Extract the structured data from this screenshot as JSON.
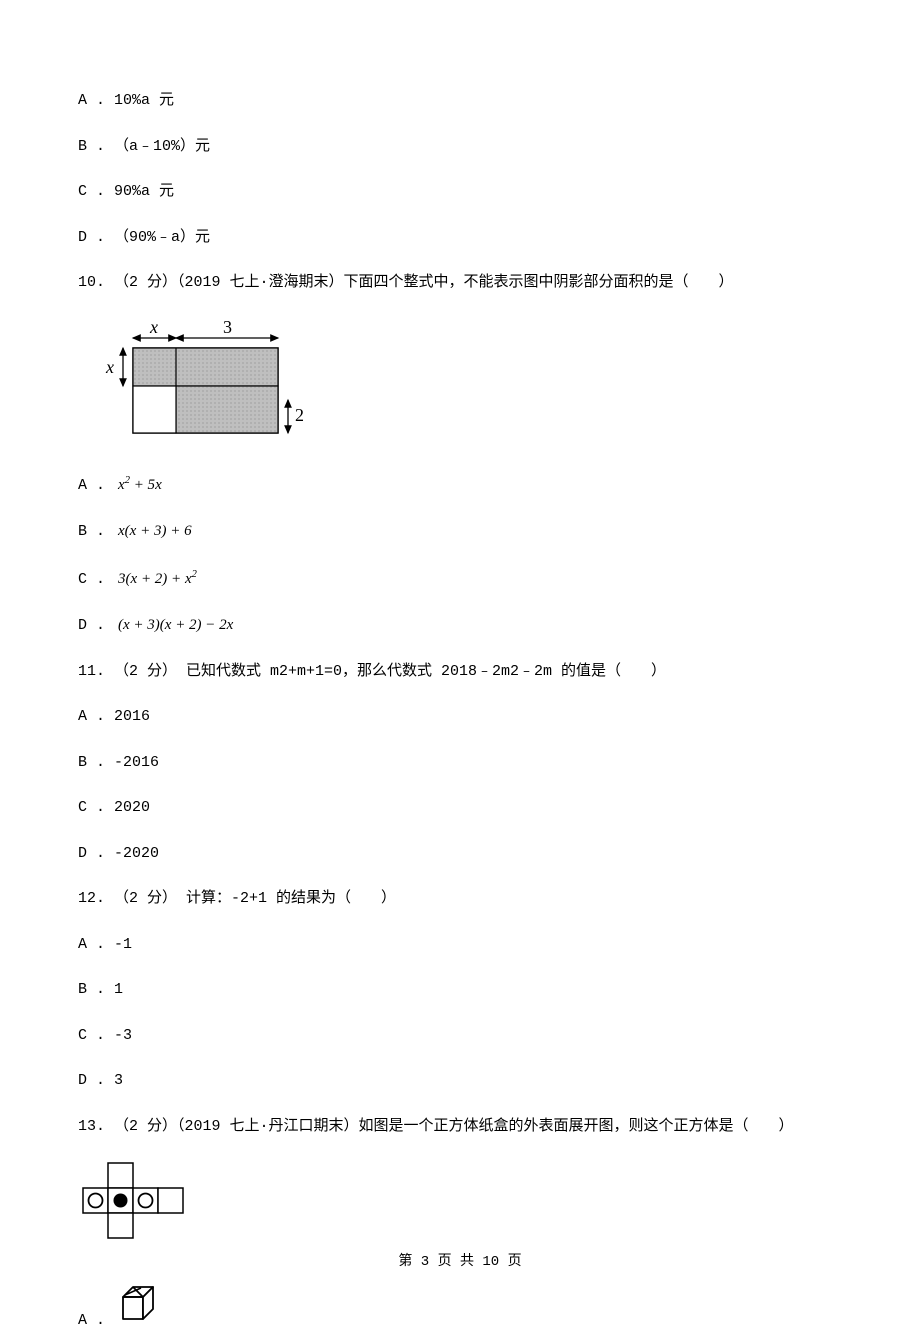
{
  "options_pre": {
    "a": "A . 10%a 元",
    "b": "B . （a﹣10%）元",
    "c": "C . 90%a 元",
    "d": "D . （90%﹣a）元"
  },
  "q10": {
    "stem": "10. （2 分）（2019 七上·澄海期末）下面四个整式中，不能表示图中阴影部分面积的是（　　）",
    "optA_prefix": "A . ",
    "optA_formula": "x² + 5x",
    "optB_prefix": "B . ",
    "optB_formula": "x(x + 3) + 6",
    "optC_prefix": "C . ",
    "optC_formula": "3(x + 2) + x²",
    "optD_prefix": "D . ",
    "optD_formula": "(x + 3)(x + 2) − 2x",
    "diagram": {
      "x_label": "x",
      "three_label": "3",
      "two_label": "2"
    }
  },
  "q11": {
    "stem": "11. （2 分） 已知代数式 m2+m+1=0，那么代数式 2018﹣2m2﹣2m 的值是（　　）",
    "a": "A . 2016",
    "b": "B . -2016",
    "c": "C . 2020",
    "d": "D . -2020"
  },
  "q12": {
    "stem": "12. （2 分） 计算：-2+1 的结果为（　　）",
    "a": "A . -1",
    "b": "B . 1",
    "c": "C . -3",
    "d": "D . 3"
  },
  "q13": {
    "stem": "13. （2 分）（2019 七上·丹江口期末）如图是一个正方体纸盒的外表面展开图，则这个正方体是（　　）",
    "optA_prefix": "A . "
  },
  "footer": "第 3 页 共 10 页",
  "chart_data": {
    "type": "table",
    "description": "Math exam questions 10-13 with multiple choice options",
    "questions": [
      {
        "number": "(partial)",
        "options": [
          "10%a 元",
          "（a﹣10%）元",
          "90%a 元",
          "（90%﹣a）元"
        ]
      },
      {
        "number": 10,
        "points": 2,
        "source": "2019 七上·澄海期末",
        "text": "下面四个整式中，不能表示图中阴影部分面积的是",
        "diagram": {
          "width_segments": [
            "x",
            "3"
          ],
          "height_segments": [
            "x",
            "2"
          ],
          "shaded": "L-shape (full minus bottom-left 2×x)"
        },
        "options": [
          "x²+5x",
          "x(x+3)+6",
          "3(x+2)+x²",
          "(x+3)(x+2)−2x"
        ]
      },
      {
        "number": 11,
        "points": 2,
        "text": "已知代数式 m²+m+1=0，那么代数式 2018−2m²−2m 的值是",
        "options": [
          "2016",
          "-2016",
          "2020",
          "-2020"
        ]
      },
      {
        "number": 12,
        "points": 2,
        "text": "计算：-2+1 的结果为",
        "options": [
          "-1",
          "1",
          "-3",
          "3"
        ]
      },
      {
        "number": 13,
        "points": 2,
        "source": "2019 七上·丹江口期末",
        "text": "如图是一个正方体纸盒的外表面展开图，则这个正方体是",
        "net": {
          "shape": "T-cross",
          "faces": [
            "blank",
            "open-circle",
            "filled-circle",
            "open-circle",
            "blank",
            "blank"
          ]
        },
        "option_A": "cube with diagonal on top face"
      }
    ]
  }
}
